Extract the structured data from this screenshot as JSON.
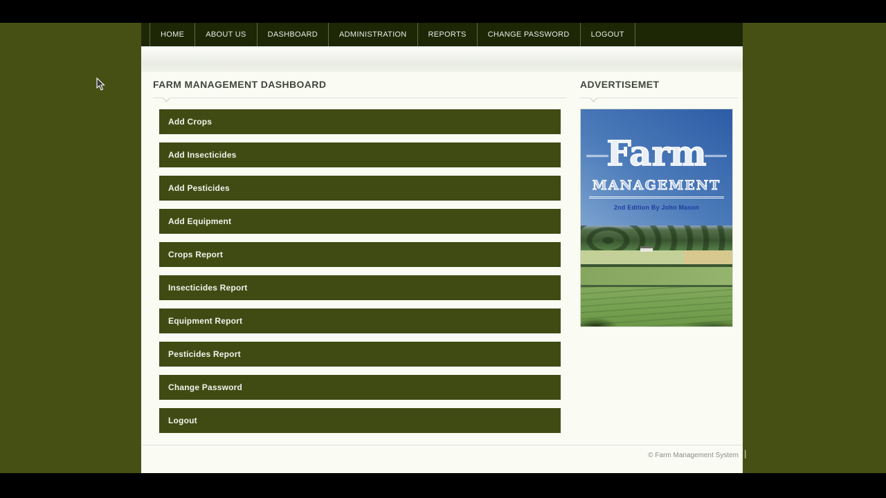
{
  "nav": {
    "items": [
      "HOME",
      "ABOUT US",
      "DASHBOARD",
      "ADMINISTRATION",
      "REPORTS",
      "CHANGE PASSWORD",
      "LOGOUT"
    ]
  },
  "dashboard": {
    "heading": "FARM MANAGEMENT DASHBOARD",
    "buttons": [
      "Add Crops",
      "Add Insecticides",
      "Add Pesticides",
      "Add Equipment",
      "Crops Report",
      "Insecticides Report",
      "Equipment Report",
      "Pesticides Report",
      "Change Password",
      "Logout"
    ]
  },
  "advertisement": {
    "heading": "ADVERTISEMET",
    "book": {
      "title": "Farm",
      "subtitle": "MANAGEMENT",
      "edition": "2nd Edition By John Mason"
    }
  },
  "footer": {
    "copyright": "© Farm Management System",
    "caret": "|"
  },
  "colors": {
    "page_background": "#465014",
    "navbar_background": "#1d2706",
    "button_background": "#3f4b13",
    "content_background": "#fafcf4",
    "sky_top": "#2d5ca6",
    "edition_text": "#1f3da0"
  }
}
